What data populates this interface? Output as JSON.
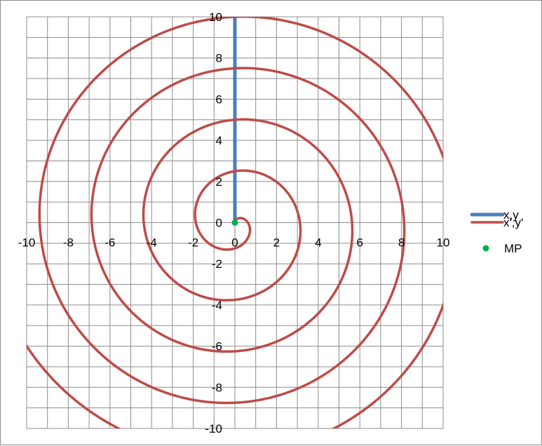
{
  "chart_data": {
    "type": "scatter",
    "title": "",
    "xlabel": "",
    "ylabel": "",
    "xlim": [
      -10,
      10
    ],
    "ylim": [
      -10,
      10
    ],
    "x_ticks": [
      -10,
      -8,
      -6,
      -4,
      -2,
      0,
      2,
      4,
      6,
      8,
      10
    ],
    "y_ticks": [
      -10,
      -8,
      -6,
      -4,
      -2,
      0,
      2,
      4,
      6,
      8,
      10
    ],
    "grid": true,
    "legend_position": "right",
    "series": [
      {
        "name": "x,y",
        "color": "#4a7ebb",
        "style": "line",
        "x": [
          0,
          0,
          0,
          0,
          0,
          0
        ],
        "y": [
          0,
          2,
          4,
          6,
          8,
          10
        ]
      },
      {
        "name": "x',y'",
        "color": "#be4b48",
        "style": "spiral",
        "r_per_turn": 2.5,
        "turns": 4.8,
        "r_min": 0,
        "r_max": 12,
        "start_angle_deg": 90,
        "direction": "clockwise"
      },
      {
        "name": "MP",
        "color": "#00b050",
        "style": "marker",
        "x": [
          0
        ],
        "y": [
          0
        ]
      }
    ]
  }
}
